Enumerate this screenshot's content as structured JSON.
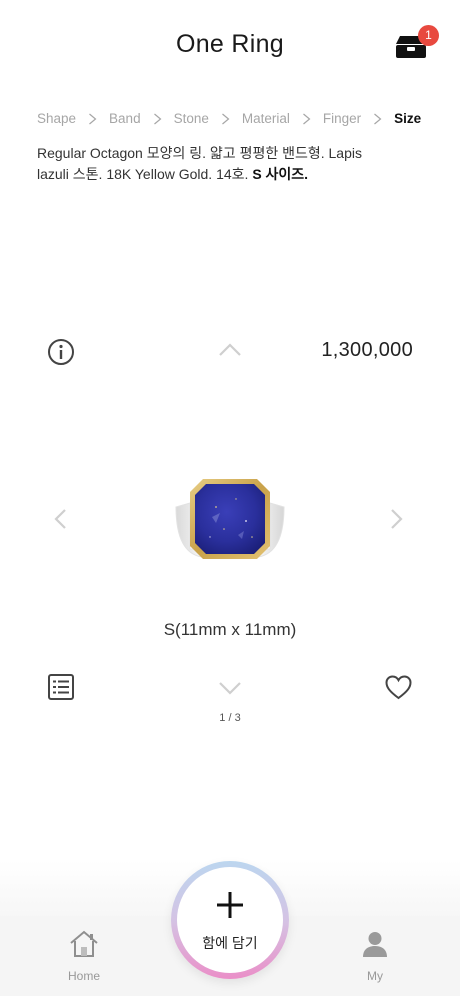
{
  "header": {
    "title": "One Ring",
    "box_badge": "1",
    "box_icon": "jewelry-box-icon"
  },
  "breadcrumb": {
    "items": [
      "Shape",
      "Band",
      "Stone",
      "Material",
      "Finger",
      "Size"
    ],
    "active_index": 5
  },
  "description": {
    "text": "Regular Octagon 모양의 링. 얇고 평평한 밴드형. Lapis lazuli 스톤. 18K Yellow Gold. 14호. ",
    "emphasis": "S 사이즈."
  },
  "product": {
    "price": "1,300,000",
    "size": "S(11mm x 11mm)",
    "pager": "1 / 3"
  },
  "actions": {
    "add_label": "함에 담기"
  },
  "tabbar": {
    "home_label": "Home",
    "my_label": "My"
  },
  "colors": {
    "badge": "#e8493f",
    "stone": "#2a2f9c",
    "gold": "#d4b25a",
    "add_ring_top": "#bcd6ef",
    "add_ring_bottom": "#ea8fc8"
  }
}
